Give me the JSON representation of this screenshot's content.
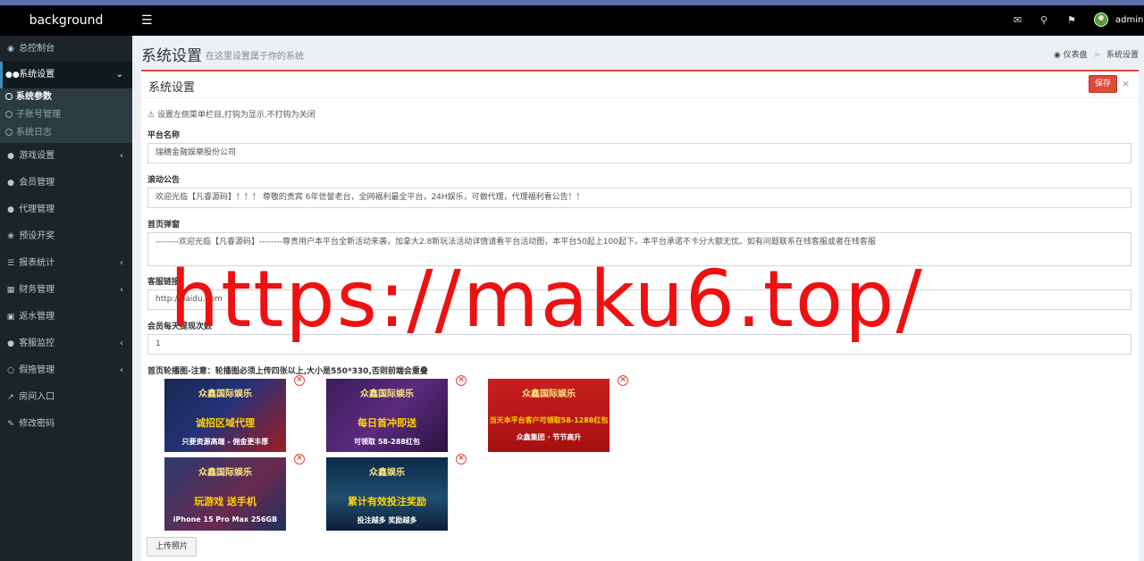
{
  "header": {
    "brand": "background",
    "menu_icon": "hamburger-icon",
    "icons": [
      "mail-icon",
      "bell-icon",
      "flag-icon"
    ],
    "username": "admin"
  },
  "sidebar": {
    "items": [
      {
        "label": "总控制台",
        "icon": "dashboard-icon"
      },
      {
        "label": "系统设置",
        "icon": "settings-icon",
        "expanded": true
      },
      {
        "label": "游戏设置",
        "icon": "gamepad-icon"
      },
      {
        "label": "会员管理",
        "icon": "users-icon"
      },
      {
        "label": "代理管理",
        "icon": "agent-icon"
      },
      {
        "label": "预设开奖",
        "icon": "preset-icon"
      },
      {
        "label": "报表统计",
        "icon": "report-icon"
      },
      {
        "label": "财务管理",
        "icon": "finance-icon"
      },
      {
        "label": "返水管理",
        "icon": "rebate-icon"
      },
      {
        "label": "客服监控",
        "icon": "monitor-icon"
      },
      {
        "label": "假拖管理",
        "icon": "chat-icon"
      },
      {
        "label": "房间入口",
        "icon": "entry-icon"
      },
      {
        "label": "修改密码",
        "icon": "password-icon"
      }
    ],
    "submenu": [
      {
        "label": "系统参数",
        "active": true
      },
      {
        "label": "子账号管理"
      },
      {
        "label": "系统日志"
      }
    ]
  },
  "content_header": {
    "title": "系统设置",
    "subtitle": "在这里设置属于你的系统",
    "breadcrumb": [
      "仪表盘",
      "系统设置"
    ]
  },
  "box": {
    "title": "系统设置",
    "save_label": "保存",
    "close_label": "×"
  },
  "form": {
    "hint": "设置左侧菜单栏目,打钩为显示,不打钩为关闭",
    "platform_name": {
      "label": "平台名称",
      "value": "瑞穗金融娱樂股份公司"
    },
    "marquee": {
      "label": "滚动公告",
      "value": "欢迎光临【凡睿源码】！！！ 尊敬的贵宾 6年信誉老台，全网福利最全平台，24H娱乐，可做代理，代理福利看公告！！"
    },
    "popup": {
      "label": "首页弹窗",
      "value": "--------欢迎光临【凡睿源码】--------尊贵用户本平台全新活动来袭，加拿大2.8新玩法活动详情请看平台活动图，本平台50起上100起下。本平台承诺不卡分大额无忧。如有问题联系在线客服或者在线客服"
    },
    "service_link": {
      "label": "客服链接",
      "value": "http://baidu.com"
    },
    "daily_withdraw": {
      "label": "会员每天提现次数",
      "value": "1"
    },
    "carousel": {
      "label": "首页轮播图-注意：轮播图必须上传四张以上,大小是550*330,否则前端会重叠",
      "banners": [
        {
          "caption": "众鑫国际娱乐",
          "headline": "诚招区域代理",
          "tagline": "只要资源高端 - 佣金更丰厚"
        },
        {
          "caption": "众鑫国际娱乐",
          "headline": "每日首冲即送",
          "tagline": "可领取 58-288红包"
        },
        {
          "caption": "众鑫国际娱乐",
          "headline": "当天本平台客户可领取58-1288红包",
          "tagline": "众鑫集团 · 节节高升"
        },
        {
          "caption": "众鑫国际娱乐",
          "headline": "玩游戏 送手机",
          "tagline": "iPhone 15 Pro Max 256GB"
        },
        {
          "caption": "众鑫娱乐",
          "headline": "累计有效投注奖励",
          "tagline": "投注越多 奖励越多"
        }
      ],
      "delete_icon": "delete-circle-icon"
    },
    "upload_label": "上传照片"
  },
  "watermark": "https://maku6.top/",
  "colors": {
    "accent": "#dd4b39",
    "sidebar_bg": "#1c2428",
    "header_bg": "#000000",
    "active_indicator": "#3c8dbc"
  }
}
